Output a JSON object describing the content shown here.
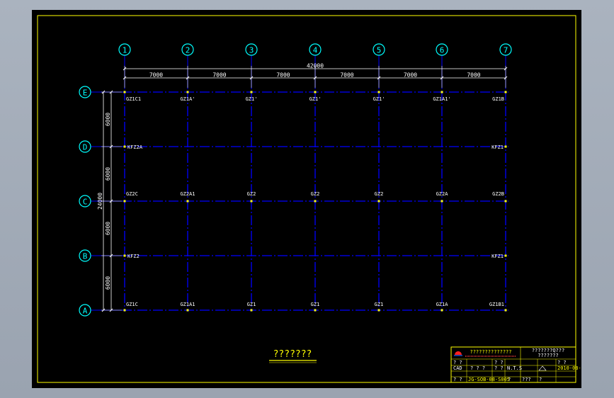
{
  "colors": {
    "frame": "#ffff00",
    "grid": "#0000ff",
    "dimension": "#ffffff",
    "bubble": "#00ffff",
    "label": "#ffffff",
    "title": "#ffff00",
    "background": "#000000"
  },
  "vertical_axes": [
    "1",
    "2",
    "3",
    "4",
    "5",
    "6",
    "7"
  ],
  "horizontal_axes": [
    "E",
    "D",
    "C",
    "B",
    "A"
  ],
  "dimensions": {
    "total_horizontal": "42000",
    "spans_horizontal": [
      "7000",
      "7000",
      "7000",
      "7000",
      "7000",
      "7000"
    ],
    "total_vertical": "24000",
    "spans_vertical": [
      "6000",
      "6000",
      "6000",
      "6000"
    ]
  },
  "column_labels": {
    "row_E": [
      "GZ1C1",
      "GZ1A'",
      "GZ1'",
      "GZ1'",
      "GZ1'",
      "GZ1A1'",
      "GZ1B"
    ],
    "row_D": [
      "KFZ2A",
      "",
      "",
      "",
      "",
      "",
      "KFZ1"
    ],
    "row_C": [
      "GZ2C",
      "GZ2A1",
      "GZ2",
      "GZ2",
      "GZ2",
      "GZ2A",
      "GZ2B"
    ],
    "row_B": [
      "KFZ2",
      "",
      "",
      "",
      "",
      "",
      "KFZ1"
    ],
    "row_A": [
      "GZ1C",
      "GZ1A1",
      "GZ1",
      "GZ1",
      "GZ1",
      "GZ1A",
      "GZ1B1"
    ]
  },
  "drawing_title": "???????",
  "title_block": {
    "company": "??????????????",
    "project": "???????Q???",
    "drawing_name": "???????",
    "r1": [
      "? ?",
      "? ?",
      "? ?"
    ],
    "r2": [
      "CAD",
      "? ? ?",
      "? ?",
      "N.T.S"
    ],
    "r3": [
      "? ?",
      "JG-SOB-08-S005",
      "?",
      "???",
      "?"
    ],
    "date": "2010-08-25"
  }
}
